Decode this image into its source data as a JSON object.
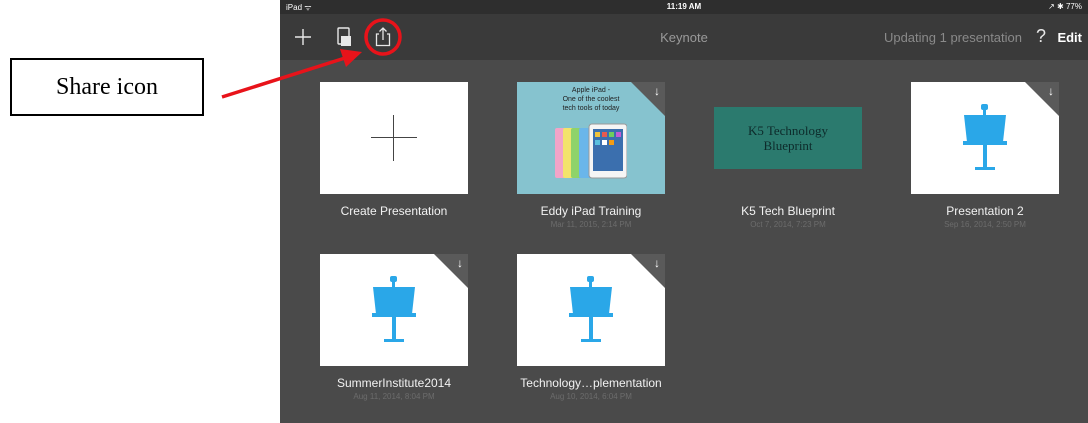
{
  "annotation": {
    "label": "Share icon"
  },
  "status_bar": {
    "left": "iPad ᯤ",
    "time": "11:19 AM",
    "right": "↗ ✱ 77%"
  },
  "toolbar": {
    "title": "Keynote",
    "status": "Updating 1 presentation",
    "help": "?",
    "edit": "Edit"
  },
  "presentations": [
    {
      "title": "Create Presentation",
      "date": ""
    },
    {
      "title": "Eddy iPad Training",
      "date": "Mar 11, 2015, 2:14 PM",
      "thumb_text": [
        "Apple iPad -",
        "One of the coolest",
        "tech tools of today"
      ]
    },
    {
      "title": "K5 Tech Blueprint",
      "date": "Oct 7, 2014, 7:23 PM",
      "thumb_text": [
        "K5 Technology",
        "Blueprint"
      ]
    },
    {
      "title": "Presentation 2",
      "date": "Sep 16, 2014, 2:50 PM"
    },
    {
      "title": "SummerInstitute2014",
      "date": "Aug 11, 2014, 8:04 PM"
    },
    {
      "title": "Technology…plementation",
      "date": "Aug 10, 2014, 6:04 PM"
    }
  ],
  "icons": {
    "download": "↓"
  },
  "colors": {
    "annotation": "#e8131a",
    "keynote_blue": "#2aa7e8"
  }
}
